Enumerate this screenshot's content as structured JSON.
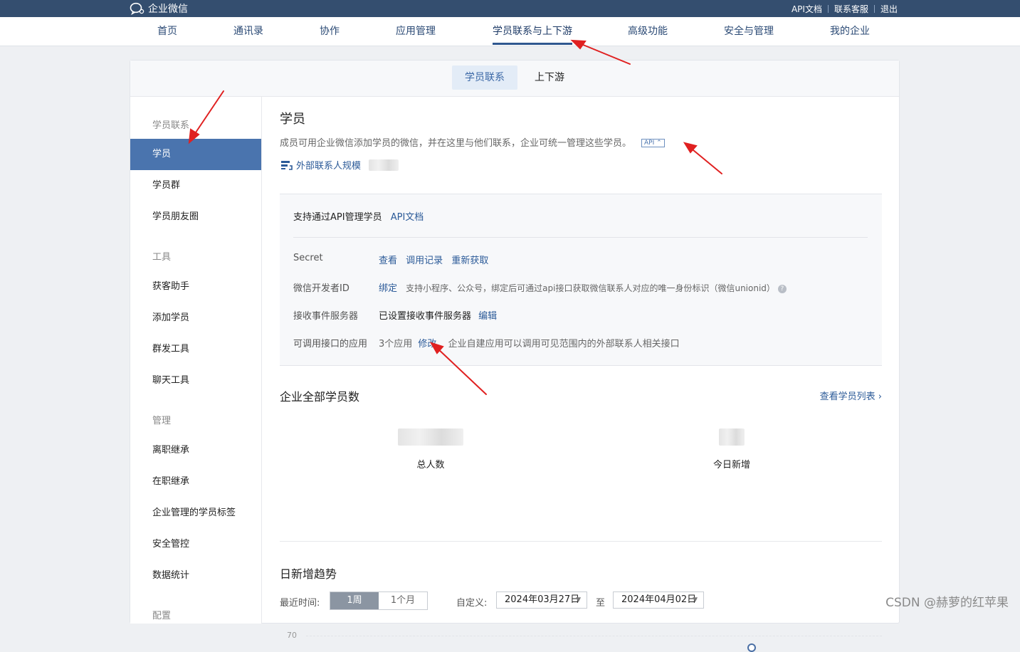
{
  "topbar": {
    "brand": "企业微信",
    "links": [
      "API文档",
      "联系客服",
      "退出"
    ]
  },
  "nav": {
    "items": [
      "首页",
      "通讯录",
      "协作",
      "应用管理",
      "学员联系与上下游",
      "高级功能",
      "安全与管理",
      "我的企业"
    ],
    "active_index": 4
  },
  "subtabs": [
    "学员联系",
    "上下游"
  ],
  "sidebar": {
    "groups": [
      "学员联系",
      "工具",
      "管理",
      "配置"
    ],
    "items": [
      "学员",
      "学员群",
      "学员朋友圈",
      "获客助手",
      "添加学员",
      "群发工具",
      "聊天工具",
      "离职继承",
      "在职继承",
      "企业管理的学员标签",
      "安全管控",
      "数据统计"
    ]
  },
  "content": {
    "title": "学员",
    "description": "成员可用企业微信添加学员的微信，并在这里与他们联系，企业可统一管理这些学员。",
    "api_badge": "API ⌃",
    "scale_link": "外部联系人规模",
    "api_box": {
      "header_text": "支持通过API管理学员",
      "header_link": "API文档",
      "secret_label": "Secret",
      "secret_links": [
        "查看",
        "调用记录",
        "重新获取"
      ],
      "devid_label": "微信开发者ID",
      "devid_link": "绑定",
      "devid_note": "支持小程序、公众号，绑定后可通过api接口获取微信联系人对应的唯一身份标识（微信unionid）",
      "help_glyph": "?",
      "event_label": "接收事件服务器",
      "event_value": "已设置接收事件服务器",
      "event_link": "编辑",
      "apps_label": "可调用接口的应用",
      "apps_value": "3个应用",
      "apps_link": "修改",
      "apps_note": "企业自建应用可以调用可见范围内的外部联系人相关接口"
    },
    "stats_title": "企业全部学员数",
    "view_list": "查看学员列表 ›",
    "stats": [
      "总人数",
      "今日新增"
    ],
    "trend_title": "日新增趋势",
    "range_label": "最近时间:",
    "range_options": [
      "1周",
      "1个月"
    ],
    "custom_label": "自定义:",
    "date_from": "2024年03月27日",
    "date_to": "2024年04月02日",
    "date_caret": "▼",
    "to_label": "至",
    "y_tick": "70"
  },
  "watermark": "CSDN @赫萝的红苹果",
  "colors": {
    "topbar": "#344e6f",
    "accent": "#4a74ae",
    "link": "#2b5a98",
    "annotation_arrow": "#e02020"
  }
}
